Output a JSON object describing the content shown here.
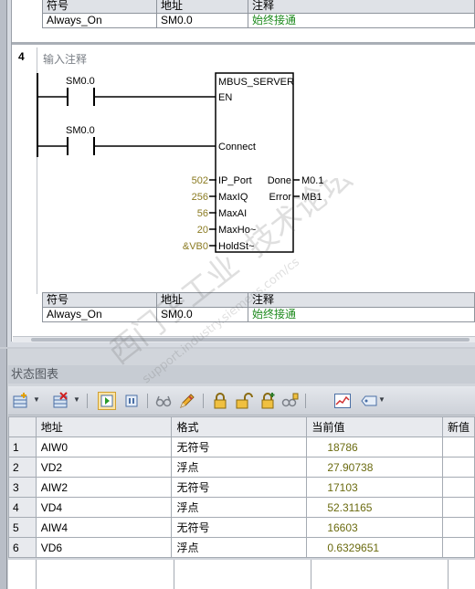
{
  "symbol_table_header": {
    "col1": "符号",
    "col2": "地址",
    "col3": "注释"
  },
  "top_symbol_row": {
    "symbol": "Always_On",
    "address": "SM0.0",
    "comment": "始终接通"
  },
  "network": {
    "number": "4",
    "comment_placeholder": "输入注释",
    "contact1": "SM0.0",
    "contact2": "SM0.0",
    "block": {
      "name": "MBUS_SERVER",
      "en": "EN",
      "connect": "Connect",
      "inputs": [
        {
          "value": "502",
          "pin": "IP_Port"
        },
        {
          "value": "256",
          "pin": "MaxIQ"
        },
        {
          "value": "56",
          "pin": "MaxAI"
        },
        {
          "value": "20",
          "pin": "MaxHo~"
        },
        {
          "value": "&VB0",
          "pin": "HoldSt~"
        }
      ],
      "outputs": [
        {
          "pin": "Done",
          "value": "M0.1"
        },
        {
          "pin": "Error",
          "value": "MB1"
        }
      ]
    }
  },
  "bottom_symbol_row": {
    "symbol": "Always_On",
    "address": "SM0.0",
    "comment": "始终接通"
  },
  "status_chart": {
    "title": "状态图表",
    "toolbar_icons": [
      "insert-row-icon",
      "delete-row-icon",
      "start-monitor-icon",
      "pause-icon",
      "glasses-icon",
      "pencil-icon",
      "lock-icon",
      "unlock-icon",
      "force-icon",
      "read-force-icon",
      "trend-icon",
      "tag-icon"
    ],
    "columns": {
      "num": "",
      "address": "地址",
      "format": "格式",
      "current": "当前值",
      "new": "新值"
    },
    "rows": [
      {
        "n": "1",
        "address": "AIW0",
        "format": "无符号",
        "current": "18786"
      },
      {
        "n": "2",
        "address": "VD2",
        "format": "浮点",
        "current": "27.90738"
      },
      {
        "n": "3",
        "address": "AIW2",
        "format": "无符号",
        "current": "17103"
      },
      {
        "n": "4",
        "address": "VD4",
        "format": "浮点",
        "current": "52.31165"
      },
      {
        "n": "5",
        "address": "AIW4",
        "format": "无符号",
        "current": "16603"
      },
      {
        "n": "6",
        "address": "VD6",
        "format": "浮点",
        "current": "0.6329651"
      }
    ]
  },
  "watermark": {
    "line1": "西门子工业",
    "line2": "技术论坛",
    "line3": "support.industry.siemens.com/cs"
  },
  "colors": {
    "comment_green": "#1d8a1d",
    "value_olive": "#6b6b10",
    "pin_value": "#8a7a20"
  }
}
